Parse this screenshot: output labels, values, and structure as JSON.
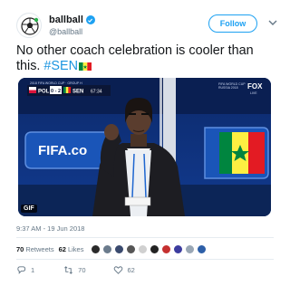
{
  "tweet": {
    "display_name": "ballball",
    "handle": "@ballball",
    "follow_label": "Follow",
    "text_main": "No other coach celebration is cooler than this.",
    "hashtag": "#SEN",
    "timestamp": "9:37 AM - 19 Jun 2018",
    "retweets_count": "70",
    "retweets_label": "Retweets",
    "likes_count": "62",
    "likes_label": "Likes",
    "reply_count": "1",
    "retweet_action_count": "70",
    "like_action_count": "62"
  },
  "media": {
    "badge": "GIF",
    "scorebug": {
      "team1": "POL",
      "score": "0 - 2",
      "team2": "SEN",
      "clock": "67:34"
    },
    "board_text": "FIFA.co",
    "channel": "FOX",
    "live_label": "LIVE"
  },
  "colors": {
    "accent": "#1da1f2",
    "hashtag": "#1b95e0",
    "muted": "#657786",
    "text": "#14171a",
    "border": "#e6ecf0"
  },
  "icons": [
    "verified-badge-icon",
    "chevron-down-icon",
    "senegal-flag-emoji",
    "reply-icon",
    "retweet-icon",
    "heart-icon"
  ],
  "likers": [
    "#2a2a2a",
    "#6b7b8c",
    "#3a4a6e",
    "#555",
    "#d0d0d0",
    "#222",
    "#c53030",
    "#3c3c9e",
    "#9aa7b5",
    "#2d5fa8"
  ]
}
